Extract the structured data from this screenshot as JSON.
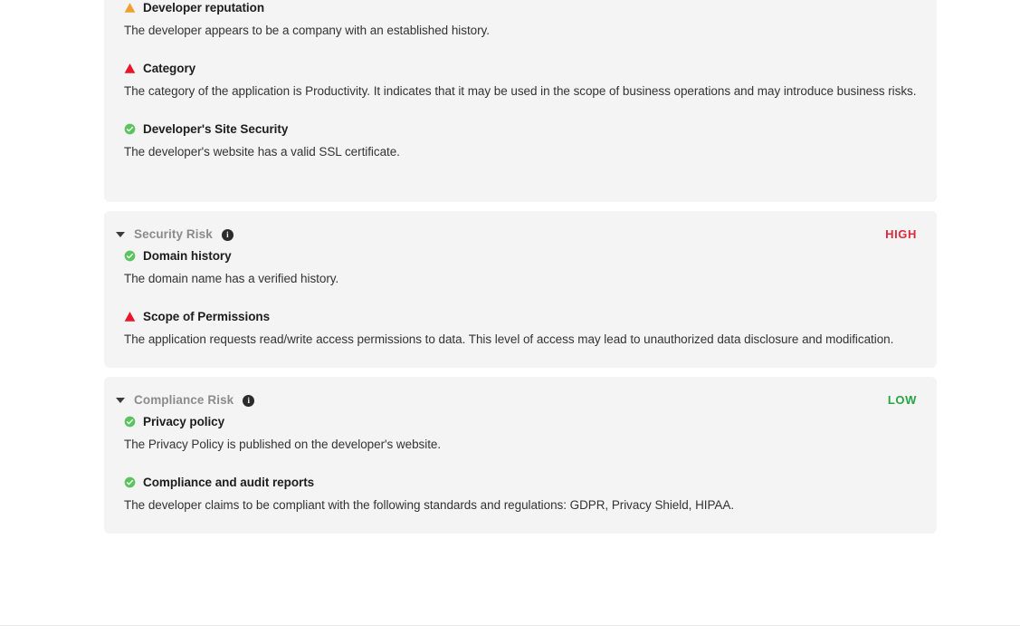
{
  "colors": {
    "danger": "#dd2b3a",
    "warning": "#f0a030",
    "success": "#4ab84f",
    "card_bg": "#f4f4f4",
    "title_gray": "#8b8b8b",
    "text": "#333333"
  },
  "cards": [
    {
      "id": "reputation-risk",
      "header_visible": false,
      "title": "",
      "level": "",
      "findings": [
        {
          "icon": "warning-triangle-icon",
          "severity": "warning",
          "title": "Developer reputation",
          "description": "The developer appears to be a company with an established history."
        },
        {
          "icon": "danger-triangle-icon",
          "severity": "danger",
          "title": "Category",
          "description": "The category of the application is Productivity. It indicates that it may be used in the scope of business operations and may introduce business risks."
        },
        {
          "icon": "success-check-icon",
          "severity": "success",
          "title": "Developer's Site Security",
          "description": "The developer's website has a valid SSL certificate."
        }
      ]
    },
    {
      "id": "security-risk",
      "header_visible": true,
      "title": "Security Risk",
      "level": "HIGH",
      "level_class": "high",
      "info_tooltip": "info-icon",
      "findings": [
        {
          "icon": "success-check-icon",
          "severity": "success",
          "title": "Domain history",
          "description": "The domain name has a verified history."
        },
        {
          "icon": "danger-triangle-icon",
          "severity": "danger",
          "title": "Scope of Permissions",
          "description": "The application requests read/write access permissions to data. This level of access may lead to unauthorized data disclosure and modification."
        }
      ]
    },
    {
      "id": "compliance-risk",
      "header_visible": true,
      "title": "Compliance Risk",
      "level": "LOW",
      "level_class": "low",
      "info_tooltip": "info-icon",
      "findings": [
        {
          "icon": "success-check-icon",
          "severity": "success",
          "title": "Privacy policy",
          "description": "The Privacy Policy is published on the developer's website."
        },
        {
          "icon": "success-check-icon",
          "severity": "success",
          "title": "Compliance and audit reports",
          "description": "The developer claims to be compliant with the following standards and regulations: GDPR, Privacy Shield, HIPAA."
        }
      ]
    }
  ]
}
